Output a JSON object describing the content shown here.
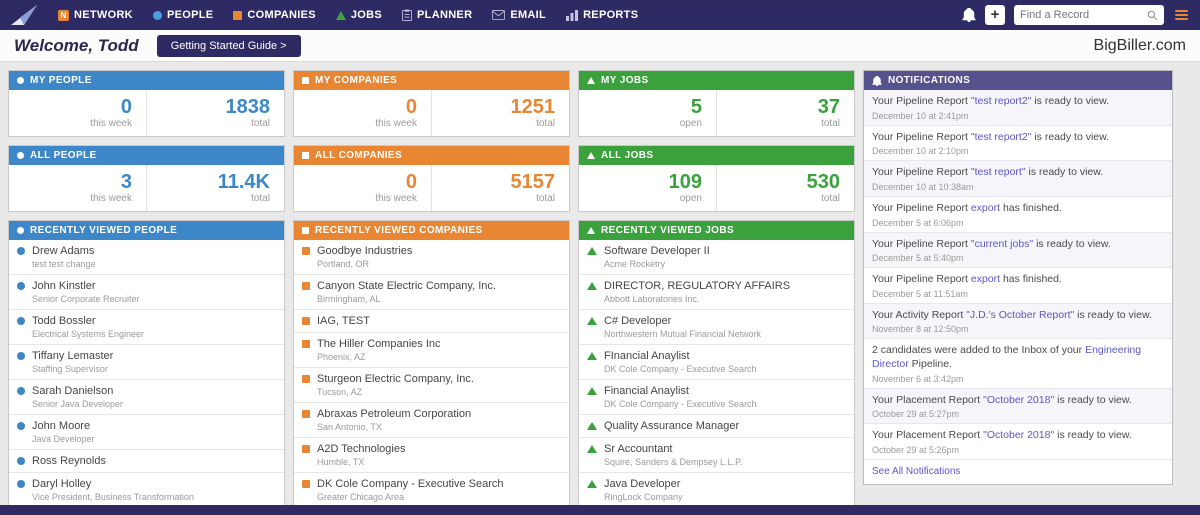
{
  "navbar": {
    "items": [
      {
        "label": "NETWORK"
      },
      {
        "label": "PEOPLE"
      },
      {
        "label": "COMPANIES"
      },
      {
        "label": "JOBS"
      },
      {
        "label": "PLANNER"
      },
      {
        "label": "EMAIL"
      },
      {
        "label": "REPORTS"
      }
    ],
    "network_icon_letter": "N",
    "add_label": "+",
    "search_placeholder": "Find a Record"
  },
  "welcome": {
    "title": "Welcome, Todd",
    "guide_button": "Getting Started Guide >",
    "brand": "BigBiller.com"
  },
  "colors": {
    "navy": "#2e2b64",
    "blue": "#3d87c8",
    "orange": "#e98633",
    "green": "#3aa13c",
    "notifications_header": "#55528e",
    "link": "#5b57c7"
  },
  "cards": {
    "my_people": {
      "title": "MY PEOPLE",
      "left_value": "0",
      "left_label": "this week",
      "right_value": "1838",
      "right_label": "total"
    },
    "all_people": {
      "title": "ALL PEOPLE",
      "left_value": "3",
      "left_label": "this week",
      "right_value": "11.4K",
      "right_label": "total"
    },
    "my_companies": {
      "title": "MY COMPANIES",
      "left_value": "0",
      "left_label": "this week",
      "right_value": "1251",
      "right_label": "total"
    },
    "all_companies": {
      "title": "ALL COMPANIES",
      "left_value": "0",
      "left_label": "this week",
      "right_value": "5157",
      "right_label": "total"
    },
    "my_jobs": {
      "title": "MY JOBS",
      "left_value": "5",
      "left_label": "open",
      "right_value": "37",
      "right_label": "total"
    },
    "all_jobs": {
      "title": "ALL JOBS",
      "left_value": "109",
      "left_label": "open",
      "right_value": "530",
      "right_label": "total"
    }
  },
  "recent_people": {
    "title": "RECENTLY VIEWED PEOPLE",
    "items": [
      {
        "name": "Drew Adams",
        "subtitle": "test test change"
      },
      {
        "name": "John Kinstler",
        "subtitle": "Senior Corporate Recruiter"
      },
      {
        "name": "Todd Bossler",
        "subtitle": "Electrical Systems Engineer"
      },
      {
        "name": "Tiffany Lemaster",
        "subtitle": "Staffing Supervisor"
      },
      {
        "name": "Sarah Danielson",
        "subtitle": "Senior Java Developer"
      },
      {
        "name": "John Moore",
        "subtitle": "Java Developer"
      },
      {
        "name": "Ross Reynolds"
      },
      {
        "name": "Daryl Holley",
        "subtitle": "Vice President, Business Transformation"
      }
    ]
  },
  "recent_companies": {
    "title": "RECENTLY VIEWED COMPANIES",
    "items": [
      {
        "name": "Goodbye Industries",
        "subtitle": "Portland, OR"
      },
      {
        "name": "Canyon State Electric Company, Inc.",
        "subtitle": "Birmingham, AL"
      },
      {
        "name": "IAG, TEST"
      },
      {
        "name": "The Hiller Companies Inc",
        "subtitle": "Phoenix, AZ"
      },
      {
        "name": "Sturgeon Electric Company, Inc.",
        "subtitle": "Tucson, AZ"
      },
      {
        "name": "Abraxas Petroleum Corporation",
        "subtitle": "San Antonio, TX"
      },
      {
        "name": "A2D Technologies",
        "subtitle": "Humble, TX"
      },
      {
        "name": "DK Cole Company - Executive Search",
        "subtitle": "Greater Chicago Area"
      }
    ]
  },
  "recent_jobs": {
    "title": "RECENTLY VIEWED JOBS",
    "items": [
      {
        "name": "Software Developer II",
        "subtitle": "Acme Rocketry"
      },
      {
        "name": "DIRECTOR, REGULATORY AFFAIRS",
        "subtitle": "Abbott Laboratories Inc."
      },
      {
        "name": "C# Developer",
        "subtitle": "Northwestern Mutual Financial Network"
      },
      {
        "name": "FInancial Anaylist",
        "subtitle": "DK Cole Company - Executive Search"
      },
      {
        "name": "Financial Anaylist",
        "subtitle": "DK Cole Company - Executive Search"
      },
      {
        "name": "Quality Assurance Manager"
      },
      {
        "name": "Sr Accountant",
        "subtitle": "Squire, Sanders & Dempsey L.L.P."
      },
      {
        "name": "Java Developer",
        "subtitle": "RingLock Company"
      }
    ]
  },
  "notifications": {
    "title": "NOTIFICATIONS",
    "see_all": "See All Notifications",
    "items": [
      {
        "parts": [
          {
            "t": "Your Pipeline Report "
          },
          {
            "t": "\"test report2\"",
            "link": true
          },
          {
            "t": " is ready to view."
          }
        ],
        "date": "December 10 at 2:41pm"
      },
      {
        "parts": [
          {
            "t": "Your Pipeline Report "
          },
          {
            "t": "\"test report2\"",
            "link": true
          },
          {
            "t": " is ready to view."
          }
        ],
        "date": "December 10 at 2:10pm"
      },
      {
        "parts": [
          {
            "t": "Your Pipeline Report "
          },
          {
            "t": "\"test report\"",
            "link": true
          },
          {
            "t": " is ready to view."
          }
        ],
        "date": "December 10 at 10:38am"
      },
      {
        "parts": [
          {
            "t": "Your Pipeline Report "
          },
          {
            "t": "export",
            "link": true
          },
          {
            "t": " has finished."
          }
        ],
        "date": "December 5 at 6:06pm"
      },
      {
        "parts": [
          {
            "t": "Your Pipeline Report "
          },
          {
            "t": "\"current jobs\"",
            "link": true
          },
          {
            "t": " is ready to view."
          }
        ],
        "date": "December 5 at 5:40pm"
      },
      {
        "parts": [
          {
            "t": "Your Pipeline Report "
          },
          {
            "t": "export",
            "link": true
          },
          {
            "t": " has finished."
          }
        ],
        "date": "December 5 at 11:51am"
      },
      {
        "parts": [
          {
            "t": "Your Activity Report "
          },
          {
            "t": "\"J.D.'s October Report\"",
            "link": true
          },
          {
            "t": " is ready to view."
          }
        ],
        "date": "November 8 at 12:50pm"
      },
      {
        "parts": [
          {
            "t": "2 candidates were added to the Inbox of your "
          },
          {
            "t": "Engineering Director",
            "link": true
          },
          {
            "t": " Pipeline."
          }
        ],
        "date": "November 6 at 3:42pm"
      },
      {
        "parts": [
          {
            "t": "Your Placement Report "
          },
          {
            "t": "\"October 2018\"",
            "link": true
          },
          {
            "t": " is ready to view."
          }
        ],
        "date": "October 29 at 5:27pm"
      },
      {
        "parts": [
          {
            "t": "Your Placement Report "
          },
          {
            "t": "\"October 2018\"",
            "link": true
          },
          {
            "t": " is ready to view."
          }
        ],
        "date": "October 29 at 5:26pm"
      }
    ]
  }
}
